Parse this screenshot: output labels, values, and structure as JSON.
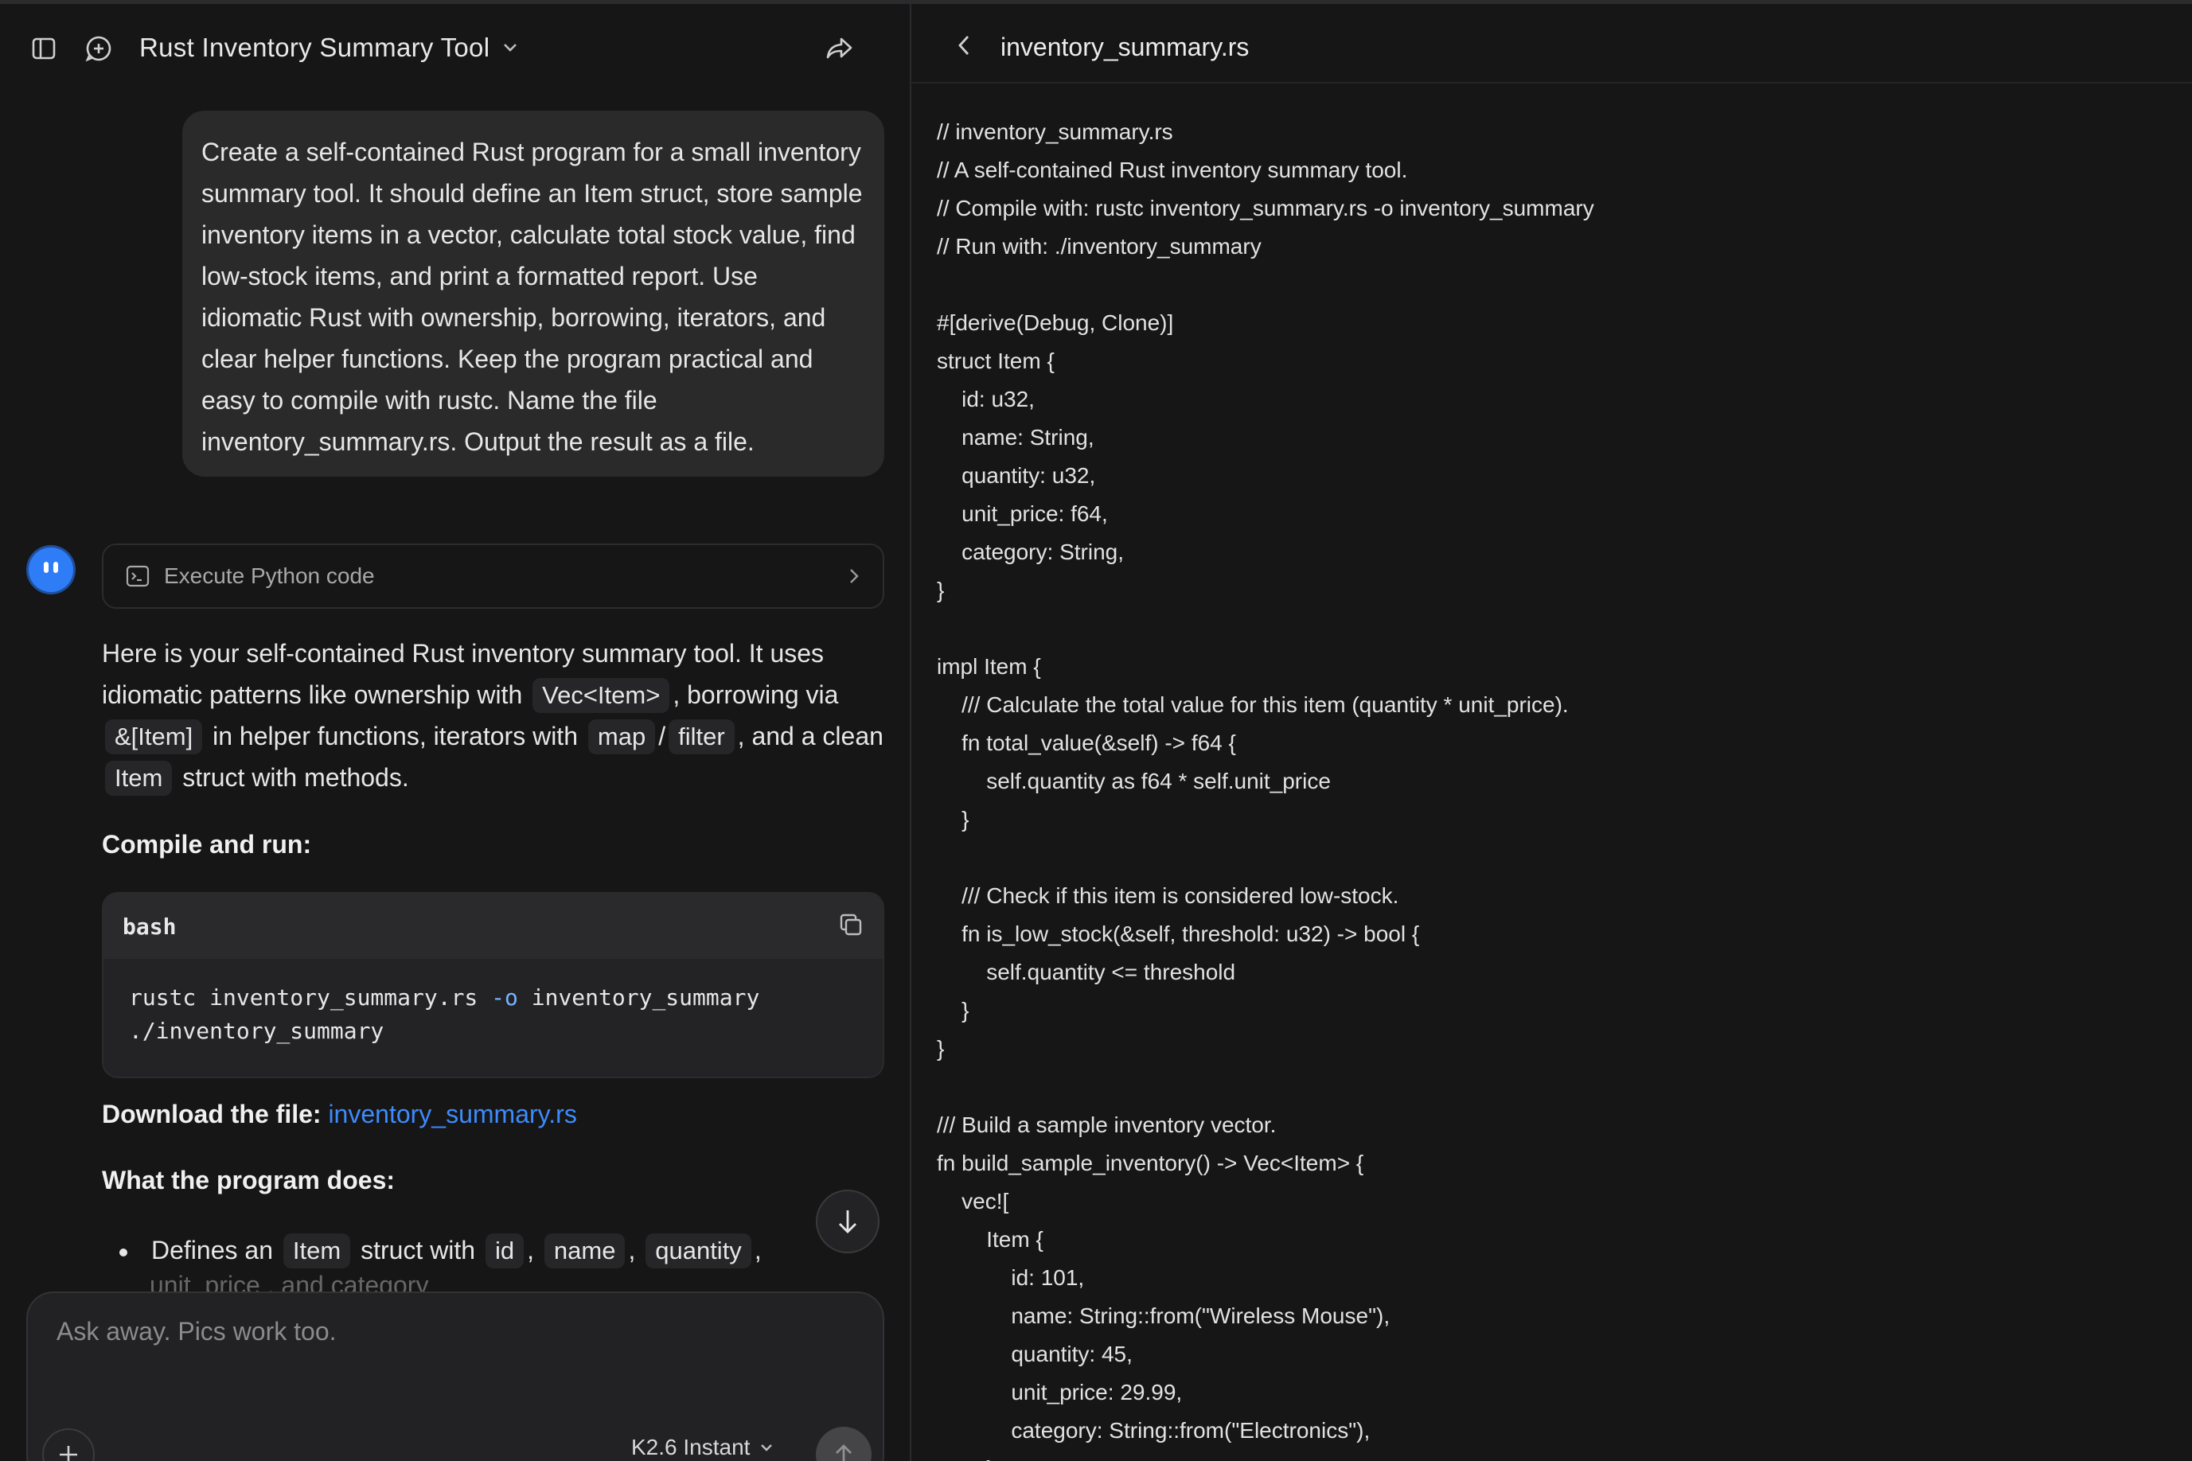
{
  "header": {
    "title": "Rust Inventory Summary Tool"
  },
  "chat": {
    "user_message": "Create a self-contained Rust program for a small inventory summary tool. It should define an Item struct, store sample inventory items in a vector, calculate total stock value, find low-stock items, and print a formatted report. Use idiomatic Rust with ownership, borrowing, iterators, and clear helper functions. Keep the program practical and easy to compile with rustc. Name the file inventory_summary.rs. Output the result as a file.",
    "tool_call_label": "Execute Python code",
    "response_intro": {
      "t1": "Here is your self-contained Rust inventory summary tool. It uses idiomatic patterns like ownership with",
      "c1": "Vec<Item>",
      "t2": ", borrowing via",
      "c2": "&[Item]",
      "t3": "in helper functions, iterators with",
      "c3": "map",
      "t4": "/",
      "c4": "filter",
      "t5": ", and a clean",
      "c5": "Item",
      "t6": "struct with methods."
    },
    "compile_heading": "Compile and run:",
    "code_block": {
      "lang": "bash",
      "line1_cmd": "rustc inventory_summary.rs ",
      "line1_flag": "-o",
      "line1_rest": " inventory_summary",
      "line2": "./inventory_summary"
    },
    "download_label": "Download the file:",
    "download_link": "inventory_summary.rs",
    "what_heading": "What the program does:",
    "bullet1": {
      "t1": "Defines an",
      "c1": "Item",
      "t2": "struct with",
      "c2": "id",
      "t3": ",",
      "c3": "name",
      "t4": ",",
      "c4": "quantity",
      "t5": ","
    },
    "bullet2_partial": "unit_price , and category"
  },
  "composer": {
    "placeholder": "Ask away. Pics work too.",
    "model": "K2.6 Instant"
  },
  "file_panel": {
    "filename": "inventory_summary.rs",
    "code_lines": [
      "// inventory_summary.rs",
      "// A self-contained Rust inventory summary tool.",
      "// Compile with: rustc inventory_summary.rs -o inventory_summary",
      "// Run with: ./inventory_summary",
      "",
      "#[derive(Debug, Clone)]",
      "struct Item {",
      "    id: u32,",
      "    name: String,",
      "    quantity: u32,",
      "    unit_price: f64,",
      "    category: String,",
      "}",
      "",
      "impl Item {",
      "    /// Calculate the total value for this item (quantity * unit_price).",
      "    fn total_value(&self) -> f64 {",
      "        self.quantity as f64 * self.unit_price",
      "    }",
      "",
      "    /// Check if this item is considered low-stock.",
      "    fn is_low_stock(&self, threshold: u32) -> bool {",
      "        self.quantity <= threshold",
      "    }",
      "}",
      "",
      "/// Build a sample inventory vector.",
      "fn build_sample_inventory() -> Vec<Item> {",
      "    vec![",
      "        Item {",
      "            id: 101,",
      "            name: String::from(\"Wireless Mouse\"),",
      "            quantity: 45,",
      "            unit_price: 29.99,",
      "            category: String::from(\"Electronics\"),",
      "        },"
    ]
  },
  "colors": {
    "background": "#161617",
    "bubble": "#2a2a2b",
    "link": "#3d8bfd",
    "avatar": "#2f7df6"
  }
}
